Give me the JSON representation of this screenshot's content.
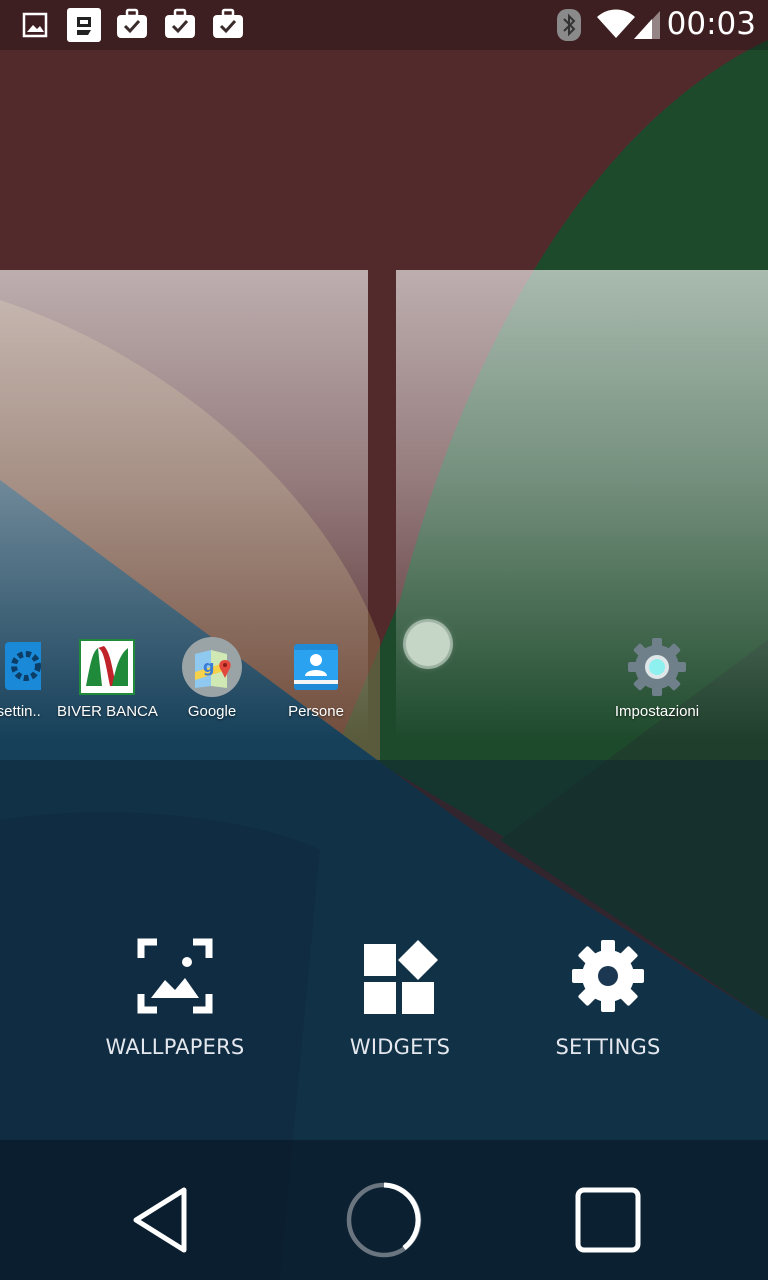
{
  "status_bar": {
    "notification_icons": [
      "gallery-icon",
      "app-notification-icon",
      "task-done-icon",
      "task-done-icon",
      "task-done-icon"
    ],
    "system_icons": [
      "bluetooth-icon",
      "wifi-icon",
      "signal-icon"
    ],
    "time": "00:03"
  },
  "home_preview": {
    "apps": [
      {
        "label": "er settin..",
        "icon": "gear-icon"
      },
      {
        "label": "BIVER BANCA",
        "icon": "biver-banca-icon"
      },
      {
        "label": "Google",
        "icon": "google-maps-icon"
      },
      {
        "label": "Persone",
        "icon": "contacts-icon"
      },
      {
        "label": "Impostazioni",
        "icon": "settings-gear-icon"
      }
    ]
  },
  "overview_options": {
    "wallpapers": "WALLPAPERS",
    "widgets": "WIDGETS",
    "settings": "SETTINGS"
  },
  "nav_bar": [
    "back-icon",
    "home-icon",
    "recents-icon"
  ],
  "colors": {
    "maroon": "#532a2c",
    "green": "#1e4a2c",
    "blue": "#16364a",
    "accent_cyan": "#8ff0f0"
  }
}
